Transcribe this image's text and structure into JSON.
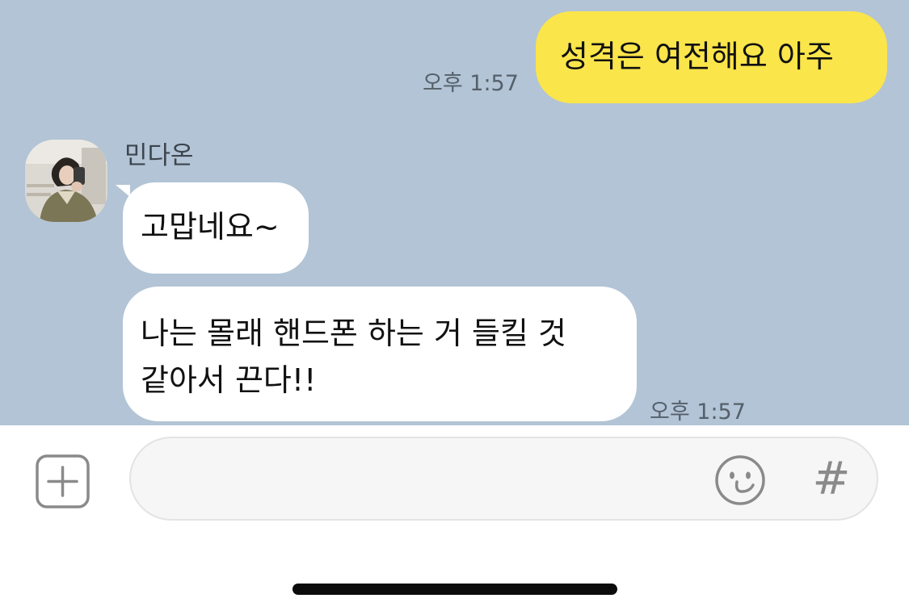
{
  "messages": [
    {
      "direction": "sent",
      "text": "성격은 여전해요 아주",
      "time": "오후 1:57"
    },
    {
      "direction": "received",
      "sender": "민다온",
      "text": "고맙네요~"
    },
    {
      "direction": "received",
      "lines": [
        "나는 몰래 핸드폰 하는 거 들킬 것",
        "같아서 끈다!!"
      ],
      "time": "오후 1:57"
    }
  ],
  "input_bar": {
    "attach_icon": "plus-square-icon",
    "emoji_icon": "smiley-icon",
    "hashtag_symbol": "#",
    "placeholder": ""
  },
  "colors": {
    "chat_background": "#b2c4d5",
    "sent_bubble": "#fae54b",
    "received_bubble": "#ffffff",
    "timestamp_text": "#55606b"
  }
}
